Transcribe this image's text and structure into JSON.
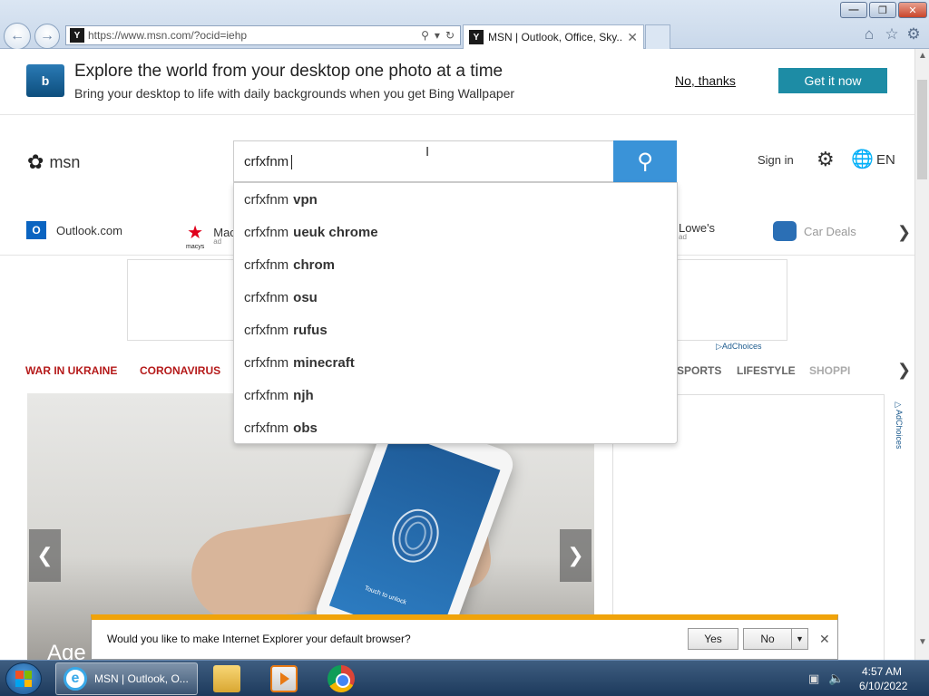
{
  "browser": {
    "address_url": "https://www.msn.com/?ocid=iehp",
    "tab_title": "MSN | Outlook, Office, Sky...",
    "favicon_letter": "Y"
  },
  "banner": {
    "title": "Explore the world from your desktop one photo at a time",
    "subtitle": "Bring your desktop to life with daily backgrounds when you get Bing Wallpaper",
    "no_thanks": "No, thanks",
    "get_it_now": "Get it now",
    "logo_letter": "b"
  },
  "header": {
    "logo_text": "msn",
    "search_value": "crfxfnm",
    "sign_in": "Sign in",
    "language": "EN"
  },
  "suggestions": [
    {
      "prefix": "crfxfnm",
      "rest": "vpn"
    },
    {
      "prefix": "crfxfnm",
      "rest": "ueuk chrome"
    },
    {
      "prefix": "crfxfnm",
      "rest": "chrom"
    },
    {
      "prefix": "crfxfnm",
      "rest": "osu"
    },
    {
      "prefix": "crfxfnm",
      "rest": "rufus"
    },
    {
      "prefix": "crfxfnm",
      "rest": "minecraft"
    },
    {
      "prefix": "crfxfnm",
      "rest": "njh"
    },
    {
      "prefix": "crfxfnm",
      "rest": "obs"
    }
  ],
  "quick_links": {
    "outlook": "Outlook.com",
    "macys": "Mac",
    "macys_sub": "macys",
    "macys_ad": "ad",
    "lowes": "Lowe's",
    "lowes_ad": "ad",
    "car_deals": "Car Deals"
  },
  "ads": {
    "adchoices": "AdChoices"
  },
  "categories": {
    "ukraine": "WAR IN UKRAINE",
    "coronavirus": "CORONAVIRUS",
    "sports": "SPORTS",
    "lifestyle": "LIFESTYLE",
    "shopping": "SHOPPI"
  },
  "hero": {
    "caption": "Age",
    "phone_text": "Touch to unlock"
  },
  "notification": {
    "text": "Would you like to make Internet Explorer your default browser?",
    "yes": "Yes",
    "no": "No"
  },
  "taskbar": {
    "ie_label": "MSN | Outlook, O...",
    "time": "4:57 AM",
    "date": "6/10/2022"
  }
}
